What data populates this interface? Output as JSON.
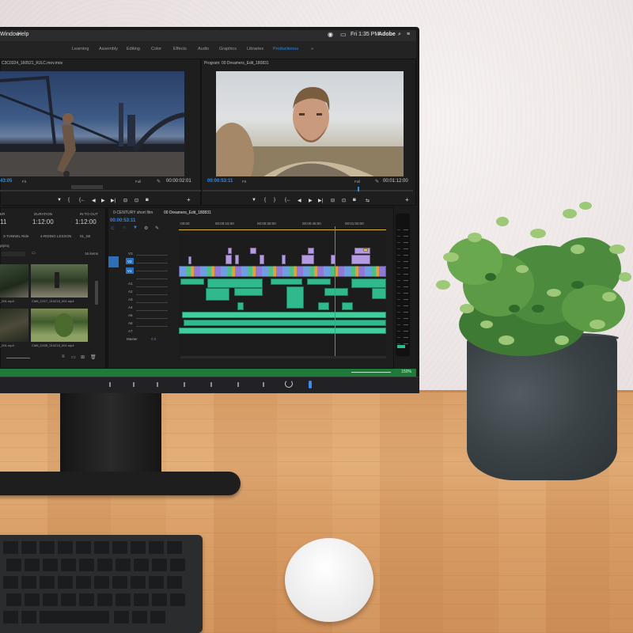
{
  "menubar": {
    "items": [
      "Window",
      "Help"
    ],
    "clock": "Fri 1:35 PM",
    "brand": "Adobe"
  },
  "workspaces": {
    "tabs": [
      "Learning",
      "Assembly",
      "Editing",
      "Color",
      "Effects",
      "Audio",
      "Graphics",
      "Libraries",
      "Productions"
    ],
    "active": "Productions",
    "overflow": "»"
  },
  "source_monitor": {
    "title": "C3C0324_160521_RJLC.mov.mov",
    "timecode": "43:05",
    "fit": "Fit",
    "quality": "Full",
    "duration": "00:00:02:01"
  },
  "program_monitor": {
    "title": "Program: 00 Dreamers_Edit_180831",
    "timecode": "00:00:53:11",
    "fit": "Fit",
    "quality": "Full",
    "duration": "00:01:12:00"
  },
  "project_panel": {
    "columns": [
      "ER",
      "DURATION",
      "IN TO OUT"
    ],
    "values": [
      "11",
      "1:12:00",
      "1:12:00"
    ],
    "bins": [
      "3-TUNNEL Ride",
      "4-RIDING LESSON",
      "01_SE"
    ],
    "project_file": "prproj",
    "item_count": "16 items",
    "clips": [
      "_001.mp4",
      "CM8_C017_010215_001.mp4",
      "_001.mp4",
      "CM8_C035_010215_001.mp4"
    ]
  },
  "timeline": {
    "sequence_tabs": [
      "0-CENTURY short film",
      "00 Dreamers_Edit_180831"
    ],
    "timecode": "00:00:53:11",
    "ruler": [
      ":00:00",
      "00:00:15:00",
      "00:00:30:00",
      "00:00:45:00",
      "00:01:00:00"
    ],
    "video_tracks": [
      "V3",
      "V2",
      "V1"
    ],
    "audio_tracks": [
      "A1",
      "A2",
      "A3",
      "A4",
      "A5",
      "A6",
      "A7"
    ],
    "master": "Master",
    "master_value": "0.0",
    "zoom": "150%"
  },
  "colors": {
    "accent": "#2d8ceb",
    "video_clip": "#b49ae0",
    "audio_clip": "#2fb98c",
    "status_bar": "#1f7a3a"
  }
}
